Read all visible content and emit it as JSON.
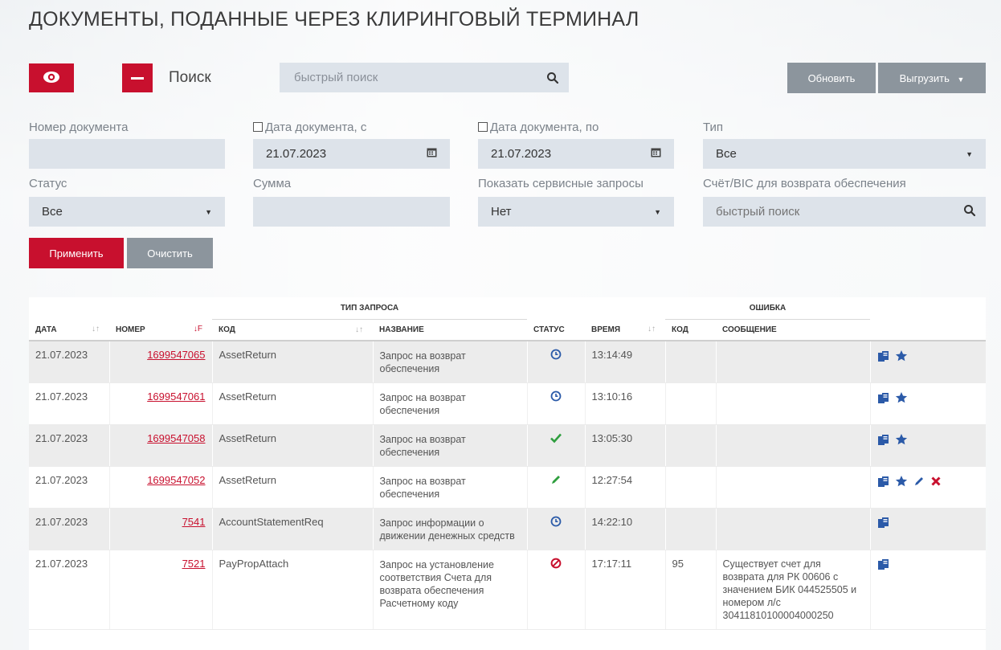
{
  "page": {
    "title": "ДОКУМЕНТЫ, ПОДАННЫЕ ЧЕРЕЗ КЛИРИНГОВЫЙ ТЕРМИНАЛ"
  },
  "toolbar": {
    "search_label": "Поиск",
    "quick_search_placeholder": "быстрый поиск",
    "refresh_label": "Обновить",
    "export_label": "Выгрузить"
  },
  "filters": {
    "doc_number_label": "Номер документа",
    "doc_number_value": "",
    "date_from_label": "Дата документа, с",
    "date_from_value": "21.07.2023",
    "date_to_label": "Дата документа, по",
    "date_to_value": "21.07.2023",
    "type_label": "Тип",
    "type_value": "Все",
    "status_label": "Статус",
    "status_value": "Все",
    "sum_label": "Сумма",
    "sum_value": "",
    "service_label": "Показать сервисные запросы",
    "service_value": "Нет",
    "account_label": "Счёт/BIC для возврата обеспечения",
    "account_placeholder": "быстрый поиск",
    "apply_label": "Применить",
    "clear_label": "Очистить"
  },
  "table": {
    "group_headers": {
      "request_type": "ТИП ЗАПРОСА",
      "error": "ОШИБКА"
    },
    "columns": {
      "date": "ДАТА",
      "number": "НОМЕР",
      "code": "КОД",
      "name": "НАЗВАНИЕ",
      "status": "СТАТУС",
      "time": "ВРЕМЯ",
      "err_code": "КОД",
      "message": "СООБЩЕНИЕ"
    },
    "rows": [
      {
        "date": "21.07.2023",
        "number": "1699547065",
        "code": "AssetReturn",
        "name": "Запрос на возврат обеспечения",
        "status": "clock-icon",
        "time": "13:14:49",
        "err_code": "",
        "message": "",
        "actions": [
          "copy-icon",
          "star-icon"
        ]
      },
      {
        "date": "21.07.2023",
        "number": "1699547061",
        "code": "AssetReturn",
        "name": "Запрос на возврат обеспечения",
        "status": "clock-icon",
        "time": "13:10:16",
        "err_code": "",
        "message": "",
        "actions": [
          "copy-icon",
          "star-icon"
        ]
      },
      {
        "date": "21.07.2023",
        "number": "1699547058",
        "code": "AssetReturn",
        "name": "Запрос на возврат обеспечения",
        "status": "check-icon",
        "time": "13:05:30",
        "err_code": "",
        "message": "",
        "actions": [
          "copy-icon",
          "star-icon"
        ]
      },
      {
        "date": "21.07.2023",
        "number": "1699547052",
        "code": "AssetReturn",
        "name": "Запрос на возврат обеспечения",
        "status": "pencil-icon",
        "time": "12:27:54",
        "err_code": "",
        "message": "",
        "actions": [
          "copy-icon",
          "star-icon",
          "pencil-icon",
          "delete-icon"
        ]
      },
      {
        "date": "21.07.2023",
        "number": "7541",
        "code": "AccountStatementReq",
        "name": "Запрос информации о движении денежных средств",
        "status": "clock-icon",
        "time": "14:22:10",
        "err_code": "",
        "message": "",
        "actions": [
          "copy-icon"
        ]
      },
      {
        "date": "21.07.2023",
        "number": "7521",
        "code": "PayPropAttach",
        "name": "Запрос на установление соответствия Счета для возврата обеспечения Расчетному коду",
        "status": "forbidden-icon",
        "time": "17:17:11",
        "err_code": "95",
        "message": "Существует счет для возврата для РК 00606 с значением БИК 044525505 и номером л/с 30411810100004000250",
        "actions": [
          "copy-icon"
        ]
      }
    ]
  },
  "colors": {
    "accent": "#c8102e",
    "button_gray": "#8c959d",
    "field_bg": "#dde3ea",
    "icon_blue": "#2b5aa8",
    "icon_green": "#2e9e3e"
  }
}
